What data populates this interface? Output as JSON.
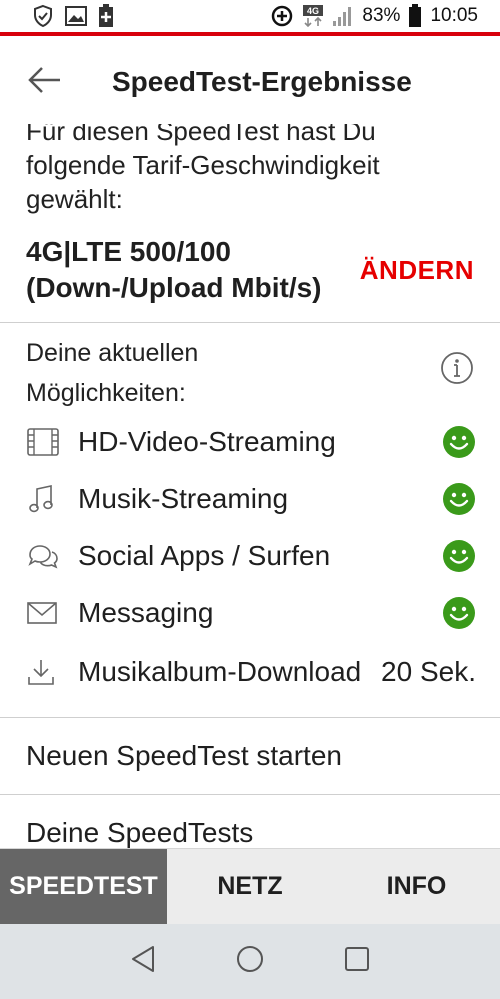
{
  "status_bar": {
    "battery_percent": "83%",
    "time": "10:05",
    "network": "4G"
  },
  "app_bar": {
    "title": "SpeedTest-Ergebnisse",
    "back_icon": "arrow-left-icon"
  },
  "tariff": {
    "intro_partial": "Für diesen SpeedTest hast Du",
    "intro_line2": "folgende Tarif-Geschwindigkeit",
    "intro_line3": "gewählt:",
    "name_line1": "4G|LTE 500/100",
    "name_line2": "(Down-/Upload Mbit/s)",
    "change_label": "ÄNDERN"
  },
  "capabilities": {
    "title_line1": "Deine aktuellen",
    "title_line2": "Möglichkeiten:",
    "items": [
      {
        "label": "HD-Video-Streaming",
        "icon": "film-icon",
        "status": "smiley-icon"
      },
      {
        "label": "Musik-Streaming",
        "icon": "music-note-icon",
        "status": "smiley-icon"
      },
      {
        "label": "Social Apps / Surfen",
        "icon": "chat-bubbles-icon",
        "status": "smiley-icon"
      },
      {
        "label": "Messaging",
        "icon": "envelope-icon",
        "status": "smiley-icon"
      },
      {
        "label": "Musikalbum-Download",
        "icon": "download-icon",
        "time": "20 Sek."
      }
    ]
  },
  "actions": {
    "new_test": "Neuen SpeedTest starten",
    "my_tests": "Deine SpeedTests"
  },
  "tabs": [
    {
      "label": "SPEEDTEST",
      "active": true
    },
    {
      "label": "NETZ",
      "active": false
    },
    {
      "label": "INFO",
      "active": false
    }
  ],
  "colors": {
    "accent_red": "#e60000",
    "smiley_green": "#3a9a1a",
    "tab_active": "#666666"
  }
}
